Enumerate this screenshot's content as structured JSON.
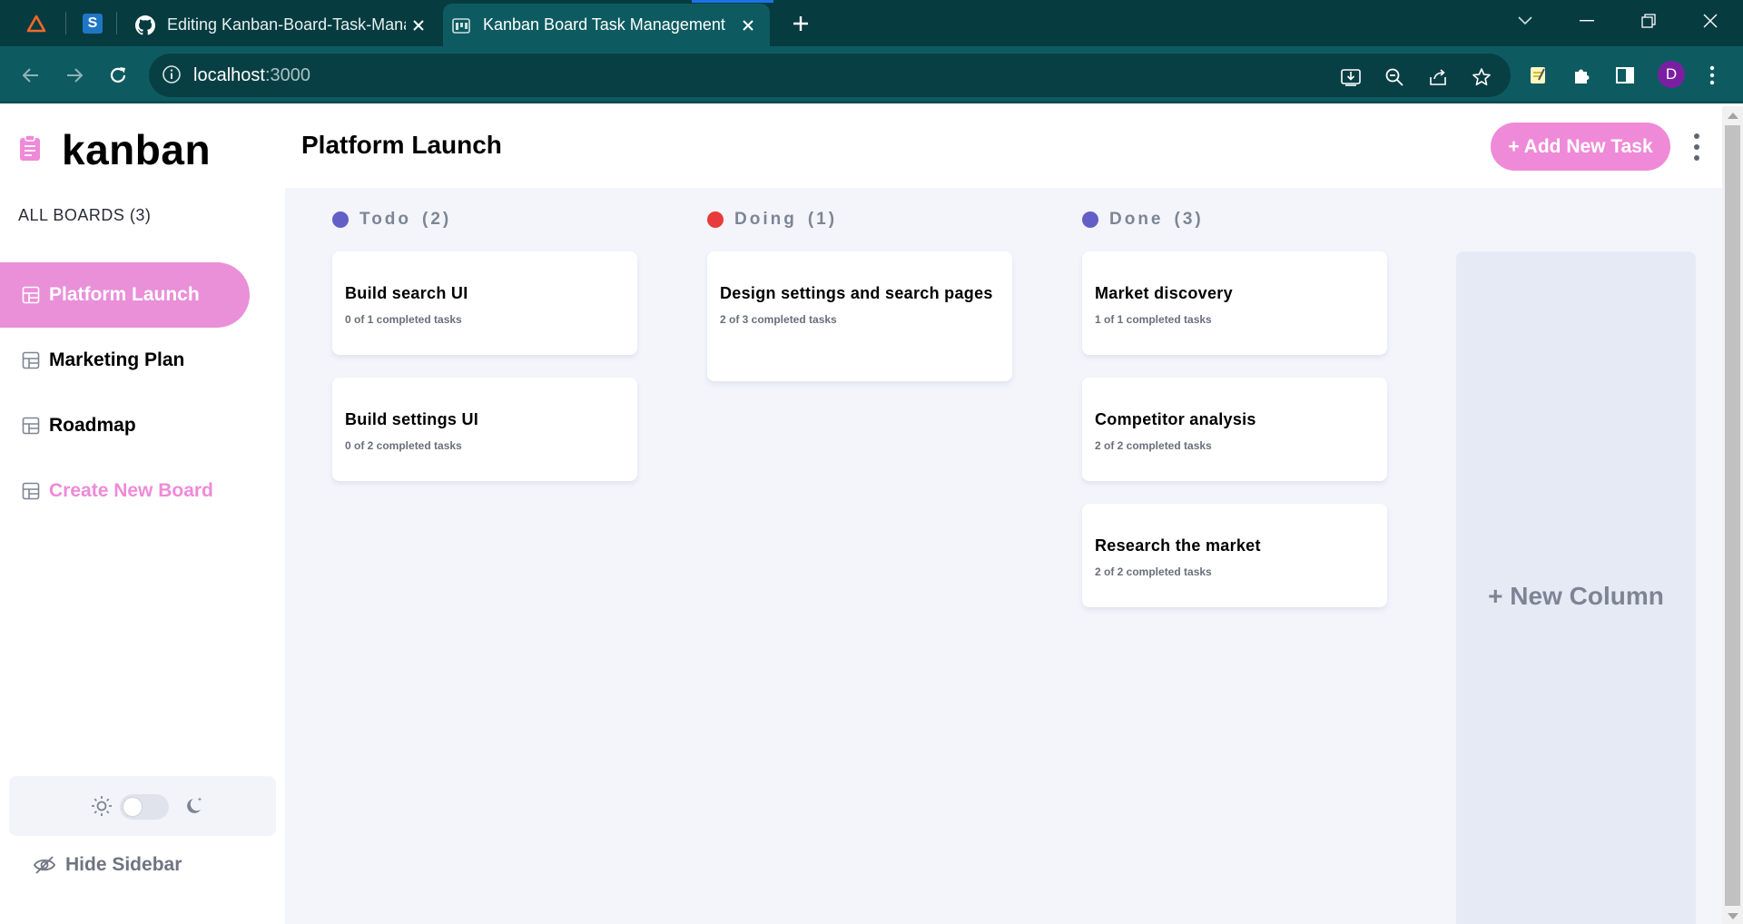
{
  "browser": {
    "tabs": [
      {
        "title": "Editing Kanban-Board-Task-Management",
        "active": false
      },
      {
        "title": "Kanban Board Task Management",
        "active": true
      }
    ],
    "url": {
      "host": "localhost",
      "port": ":3000"
    },
    "profile_initial": "D",
    "accent_color": "#0d5b60"
  },
  "sidebar": {
    "logo_text": "kanban",
    "all_boards_label": "ALL BOARDS (3)",
    "boards": [
      {
        "label": "Platform Launch",
        "active": true
      },
      {
        "label": "Marketing Plan",
        "active": false
      },
      {
        "label": "Roadmap",
        "active": false
      }
    ],
    "create_board_label": "Create New Board",
    "hide_sidebar_label": "Hide Sidebar",
    "theme": "light"
  },
  "header": {
    "board_title": "Platform Launch",
    "add_task_label": "+ Add New Task"
  },
  "columns": [
    {
      "name": "Todo",
      "count_label": "(2)",
      "dot_color": "#635fc7",
      "tasks": [
        {
          "title": "Build search UI",
          "subtasks": "0 of 1 completed tasks"
        },
        {
          "title": "Build settings UI",
          "subtasks": "0 of 2 completed tasks"
        }
      ]
    },
    {
      "name": "Doing",
      "count_label": "(1)",
      "dot_color": "#e83b3b",
      "tasks": [
        {
          "title": "Design settings and search pages",
          "subtasks": "2 of 3 completed tasks"
        }
      ]
    },
    {
      "name": "Done",
      "count_label": "(3)",
      "dot_color": "#635fc7",
      "tasks": [
        {
          "title": "Market discovery",
          "subtasks": "1 of 1 completed tasks"
        },
        {
          "title": "Competitor analysis",
          "subtasks": "2 of 2 completed tasks"
        },
        {
          "title": "Research the market",
          "subtasks": "2 of 2 completed tasks"
        }
      ]
    }
  ],
  "new_column_label": "+ New Column",
  "colors": {
    "primary": "#ef8ad8",
    "active_board": "#e990d8",
    "board_bg": "#f3f5fb"
  }
}
